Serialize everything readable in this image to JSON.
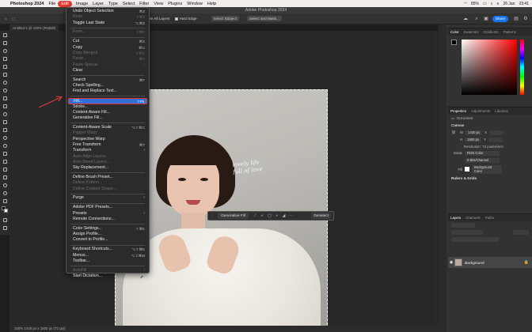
{
  "menubar": {
    "apple": "",
    "app_name": "Photoshop 2024",
    "items": [
      "File",
      "Edit",
      "Image",
      "Layer",
      "Type",
      "Select",
      "Filter",
      "View",
      "Plugins",
      "Window",
      "Help"
    ],
    "active": "Edit",
    "battery": "85%",
    "date": "26 Jan",
    "time": "23:41"
  },
  "window": {
    "title": "Adobe Photoshop 2024"
  },
  "options": {
    "rectangle_value": "Rectangle",
    "sample_all_layers": "Sample All Layers",
    "hard_edge": "Hard Edge",
    "select_subject": "Select Subject",
    "select_and_mask": "Select and Mask...",
    "share": "Share"
  },
  "doc_tab": "Untitled-1 @ 100% (RGB/8)",
  "edit_menu": {
    "items": [
      {
        "label": "Undo Object Selection",
        "shortcut": "⌘Z",
        "enabled": true
      },
      {
        "label": "Redo",
        "shortcut": "⇧⌘Z",
        "enabled": false
      },
      {
        "label": "Toggle Last State",
        "shortcut": "⌥⌘Z",
        "enabled": true
      },
      {
        "sep": true
      },
      {
        "label": "Fade...",
        "shortcut": "⇧⌘F",
        "enabled": false
      },
      {
        "sep": true
      },
      {
        "label": "Cut",
        "shortcut": "⌘X",
        "enabled": true
      },
      {
        "label": "Copy",
        "shortcut": "⌘C",
        "enabled": true
      },
      {
        "label": "Copy Merged",
        "shortcut": "⇧⌘C",
        "enabled": false
      },
      {
        "label": "Paste",
        "shortcut": "⌘V",
        "enabled": false
      },
      {
        "label": "Paste Special",
        "shortcut": "›",
        "enabled": false,
        "submenu": true
      },
      {
        "label": "Clear",
        "shortcut": "",
        "enabled": true
      },
      {
        "sep": true
      },
      {
        "label": "Search",
        "shortcut": "⌘F",
        "enabled": true
      },
      {
        "label": "Check Spelling...",
        "shortcut": "",
        "enabled": true
      },
      {
        "label": "Find and Replace Text...",
        "shortcut": "",
        "enabled": true
      },
      {
        "sep": true
      },
      {
        "label": "Fill...",
        "shortcut": "⇧F5",
        "enabled": true,
        "highlighted": true
      },
      {
        "label": "Stroke...",
        "shortcut": "",
        "enabled": true
      },
      {
        "label": "Content-Aware Fill...",
        "shortcut": "",
        "enabled": true
      },
      {
        "label": "Generative Fill...",
        "shortcut": "",
        "enabled": true
      },
      {
        "sep": true
      },
      {
        "label": "Content-Aware Scale",
        "shortcut": "⌥⇧⌘C",
        "enabled": true
      },
      {
        "label": "Puppet Warp",
        "shortcut": "",
        "enabled": false
      },
      {
        "label": "Perspective Warp",
        "shortcut": "",
        "enabled": true
      },
      {
        "label": "Free Transform",
        "shortcut": "⌘T",
        "enabled": true
      },
      {
        "label": "Transform",
        "shortcut": "›",
        "enabled": true,
        "submenu": true
      },
      {
        "label": "Auto-Align Layers...",
        "shortcut": "",
        "enabled": false
      },
      {
        "label": "Auto-Blend Layers...",
        "shortcut": "",
        "enabled": false
      },
      {
        "label": "Sky Replacement...",
        "shortcut": "",
        "enabled": true
      },
      {
        "sep": true
      },
      {
        "label": "Define Brush Preset...",
        "shortcut": "",
        "enabled": true
      },
      {
        "label": "Define Pattern...",
        "shortcut": "",
        "enabled": false
      },
      {
        "label": "Define Custom Shape...",
        "shortcut": "",
        "enabled": false
      },
      {
        "sep": true
      },
      {
        "label": "Purge",
        "shortcut": "›",
        "enabled": true,
        "submenu": true
      },
      {
        "sep": true
      },
      {
        "label": "Adobe PDF Presets...",
        "shortcut": "",
        "enabled": true
      },
      {
        "label": "Presets",
        "shortcut": "›",
        "enabled": true,
        "submenu": true
      },
      {
        "label": "Remote Connections...",
        "shortcut": "",
        "enabled": true
      },
      {
        "sep": true
      },
      {
        "label": "Color Settings...",
        "shortcut": "⇧⌘K",
        "enabled": true
      },
      {
        "label": "Assign Profile...",
        "shortcut": "",
        "enabled": true
      },
      {
        "label": "Convert to Profile...",
        "shortcut": "",
        "enabled": true
      },
      {
        "sep": true
      },
      {
        "label": "Keyboard Shortcuts...",
        "shortcut": "⌥⇧⌘K",
        "enabled": true
      },
      {
        "label": "Menus...",
        "shortcut": "⌥⇧⌘M",
        "enabled": true
      },
      {
        "label": "Toolbar...",
        "shortcut": "",
        "enabled": true
      },
      {
        "sep": true
      },
      {
        "label": "AutoFill",
        "shortcut": "›",
        "enabled": false,
        "submenu": true
      },
      {
        "label": "Start Dictation...",
        "shortcut": "🎤",
        "enabled": true
      }
    ]
  },
  "taskbar": {
    "generative_fill": "Generative Fill",
    "deselect": "Deselect",
    "icons": [
      "select-icon",
      "mask-icon",
      "rectangle-icon",
      "adjustment-icon",
      "fill-icon",
      "more-icon"
    ]
  },
  "status": "100%     1440 px x 1800 px (72 ppi)",
  "color_panel": {
    "tabs": [
      "Color",
      "Swatches",
      "Gradients",
      "Patterns"
    ]
  },
  "properties_panel": {
    "tabs": [
      "Properties",
      "Adjustments",
      "Libraries"
    ],
    "doc_label": "Document",
    "canvas_heading": "Canvas",
    "w": "1440 px",
    "h": "1800 px",
    "x_label": "X",
    "y_label": "Y",
    "resolution": "Resolution: 72 pixels/inch",
    "mode_label": "Mode",
    "mode": "RGB Color",
    "depth": "8 Bits/Channel",
    "fill_label": "Fill",
    "fill_value": "Background Color",
    "rulers_heading": "Rulers & Grids"
  },
  "layers_panel": {
    "tabs": [
      "Layers",
      "Channels",
      "Paths"
    ],
    "layer_name": "Background"
  },
  "photo_text": "lovely life\nfull of love"
}
